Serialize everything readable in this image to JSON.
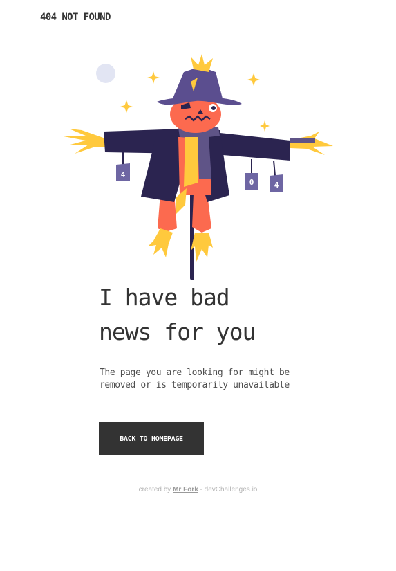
{
  "header": {
    "logo_text": "404 NOT FOUND"
  },
  "illustration": {
    "icon": "scarecrow-illustration",
    "can_labels": [
      "4",
      "0",
      "4"
    ],
    "colors": {
      "hat": "#5b4e8f",
      "coat": "#2b2450",
      "pumpkin": "#fc6a4f",
      "straw": "#ffc93d",
      "scarf": "#5f5487",
      "can": "#6e66a3",
      "moon": "#e2e5f3"
    }
  },
  "main": {
    "headline_line1": "I have bad",
    "headline_line2": "news for you",
    "description_line1": "The page you are looking for might be",
    "description_line2": "removed or is temporarily unavailable",
    "button_label": "BACK TO HOMEPAGE"
  },
  "footer": {
    "prefix": "created by ",
    "author": "Mr Fork",
    "suffix": " - devChallenges.io"
  },
  "colors": {
    "text": "#333333",
    "button_bg": "#333333",
    "button_text": "#ffffff",
    "footer_text": "#b3b3b3"
  }
}
